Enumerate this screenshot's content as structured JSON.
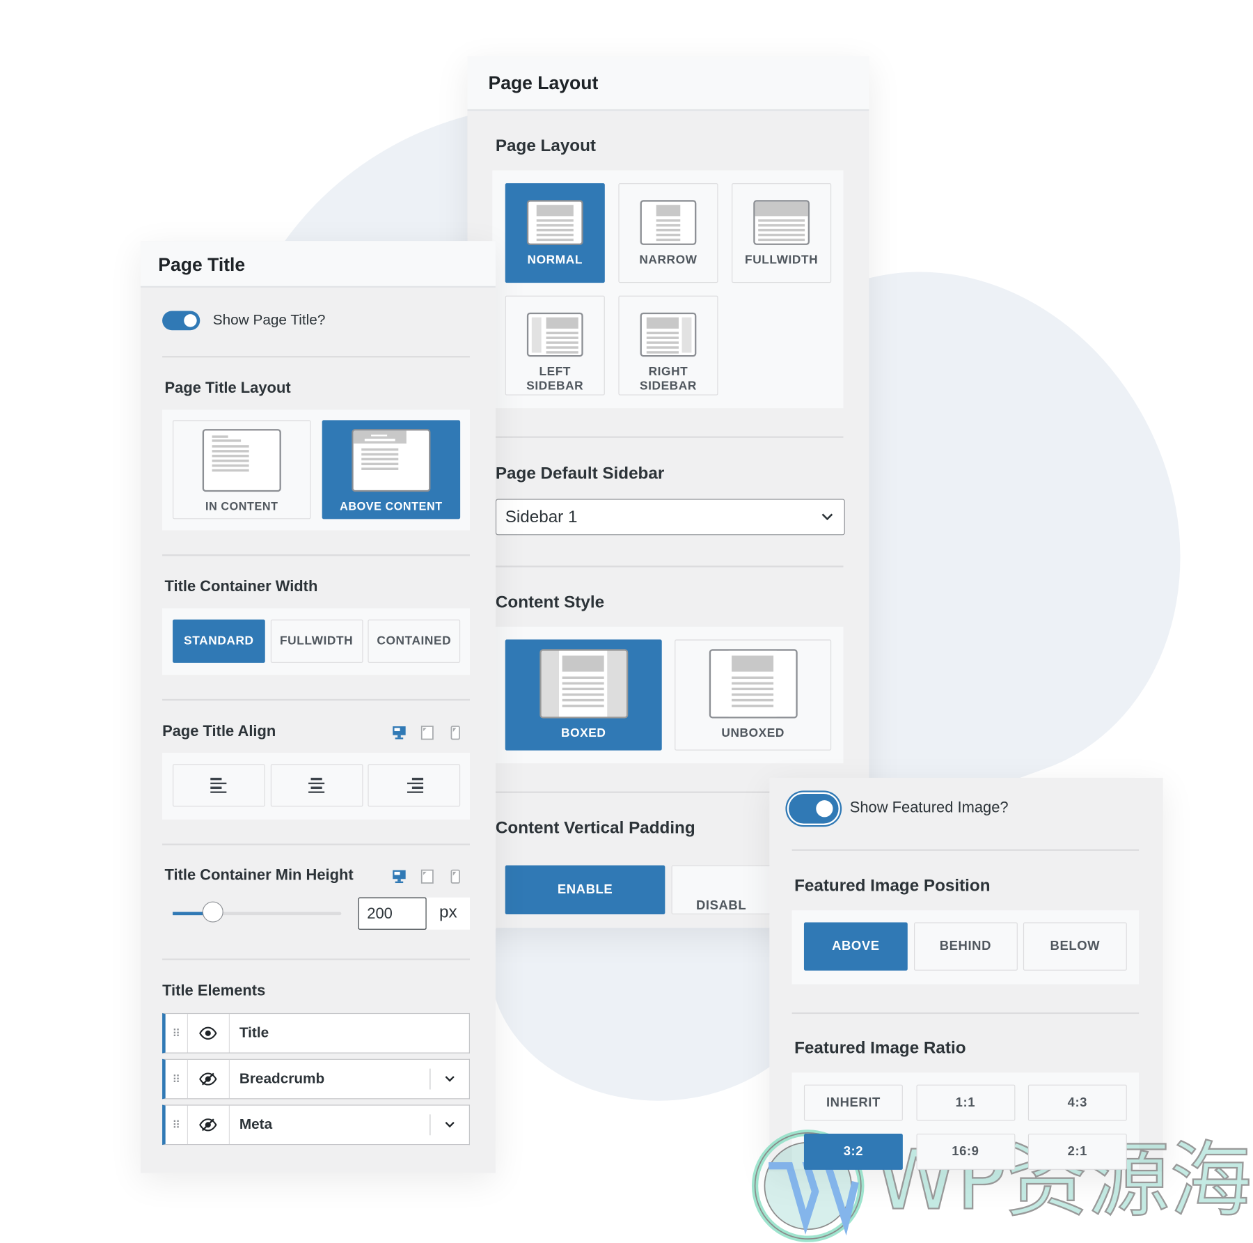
{
  "colors": {
    "accent": "#3079b5",
    "panel_bg": "#f0f0f1",
    "text": "#2c3338"
  },
  "page_title_panel": {
    "title": "Page Title",
    "show_toggle": {
      "label": "Show Page Title?",
      "on": true
    },
    "layout": {
      "label": "Page Title Layout",
      "options": [
        {
          "label": "IN CONTENT",
          "thumb": "in-content",
          "selected": false
        },
        {
          "label": "ABOVE CONTENT",
          "thumb": "above-content",
          "selected": true
        }
      ]
    },
    "width": {
      "label": "Title Container Width",
      "options": [
        {
          "label": "STANDARD",
          "selected": true
        },
        {
          "label": "FULLWIDTH",
          "selected": false
        },
        {
          "label": "CONTAINED",
          "selected": false
        }
      ]
    },
    "align": {
      "label": "Page Title Align",
      "device_icons": [
        "desktop-icon",
        "tablet-icon",
        "mobile-icon"
      ],
      "options": [
        "align-left-icon",
        "align-center-icon",
        "align-right-icon"
      ]
    },
    "min_height": {
      "label": "Title Container Min Height",
      "value": "200",
      "unit": "px",
      "slider_fraction": 0.24
    },
    "elements": {
      "label": "Title Elements",
      "items": [
        {
          "label": "Title",
          "visible": true,
          "expandable": false
        },
        {
          "label": "Breadcrumb",
          "visible": false,
          "expandable": true
        },
        {
          "label": "Meta",
          "visible": false,
          "expandable": true
        }
      ]
    }
  },
  "page_layout_panel": {
    "title": "Page Layout",
    "layout": {
      "label": "Page Layout",
      "options": [
        {
          "label": "NORMAL",
          "thumb": "normal",
          "selected": true
        },
        {
          "label": "NARROW",
          "thumb": "narrow",
          "selected": false
        },
        {
          "label": "FULLWIDTH",
          "thumb": "fullwidth",
          "selected": false
        },
        {
          "label": "LEFT\nSIDEBAR",
          "thumb": "left",
          "selected": false
        },
        {
          "label": "RIGHT\nSIDEBAR",
          "thumb": "right",
          "selected": false
        }
      ]
    },
    "sidebar": {
      "label": "Page Default Sidebar",
      "value": "Sidebar 1"
    },
    "content_style": {
      "label": "Content Style",
      "options": [
        {
          "label": "BOXED",
          "selected": true
        },
        {
          "label": "UNBOXED",
          "selected": false
        }
      ]
    },
    "padding": {
      "label": "Content Vertical Padding",
      "options": [
        {
          "label": "ENABLE",
          "selected": true
        },
        {
          "label": "DISABL",
          "selected": false
        }
      ]
    }
  },
  "featured_panel": {
    "show_toggle": {
      "label": "Show Featured Image?",
      "on": true
    },
    "position": {
      "label": "Featured Image Position",
      "options": [
        {
          "label": "ABOVE",
          "selected": true
        },
        {
          "label": "BEHIND",
          "selected": false
        },
        {
          "label": "BELOW",
          "selected": false
        }
      ]
    },
    "ratio": {
      "label": "Featured Image Ratio",
      "options": [
        {
          "label": "INHERIT",
          "selected": false
        },
        {
          "label": "1:1",
          "selected": false
        },
        {
          "label": "4:3",
          "selected": false
        },
        {
          "label": "3:2",
          "selected": true
        },
        {
          "label": "16:9",
          "selected": false
        },
        {
          "label": "2:1",
          "selected": false
        }
      ]
    }
  },
  "watermark": {
    "text": "WP资源海"
  }
}
